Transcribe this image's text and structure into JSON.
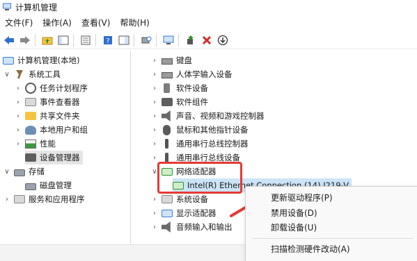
{
  "window": {
    "title": "计算机管理"
  },
  "menu": [
    "文件(F)",
    "操作(A)",
    "查看(V)",
    "帮助(H)"
  ],
  "toolbar": {
    "icons": [
      "back-arrow-icon",
      "forward-arrow-icon",
      "up-folder-icon",
      "show-tree-icon",
      "properties-icon",
      "help-icon",
      "show-hide-icon",
      "scan-hardware-icon",
      "monitor-icon",
      "update-driver-icon",
      "uninstall-icon",
      "download-icon"
    ]
  },
  "left_tree": {
    "root": "计算机管理(本地)",
    "system_tools": "系统工具",
    "task_scheduler": "任务计划程序",
    "event_viewer": "事件查看器",
    "shared_folders": "共享文件夹",
    "local_users": "本地用户和组",
    "performance": "性能",
    "device_manager": "设备管理器",
    "storage": "存储",
    "disk_management": "磁盘管理",
    "services_apps": "服务和应用程序"
  },
  "devices": {
    "keyboard": "键盘",
    "hid": "人体学输入设备",
    "software_devices": "软件设备",
    "software_components": "软件组件",
    "audio": "声音、视频和游戏控制器",
    "mouse": "鼠标和其他指针设备",
    "usb1": "通用串行总线控制器",
    "usb2": "通用串行总线设备",
    "network_adapters": "网络适配器",
    "ethernet": "Intel(R) Ethernet Connection (14) I219-V",
    "system_devices": "系统设备",
    "display_adapters": "显示适配器",
    "audio_io": "音频输入和输出"
  },
  "context_menu": {
    "update_driver": "更新驱动程序(P)",
    "disable_device": "禁用设备(D)",
    "uninstall_device": "卸载设备(U)",
    "scan_hardware": "扫描检测硬件改动(A)"
  },
  "colors": {
    "annotation_red": "#e53935",
    "selection": "#cce4f7"
  }
}
